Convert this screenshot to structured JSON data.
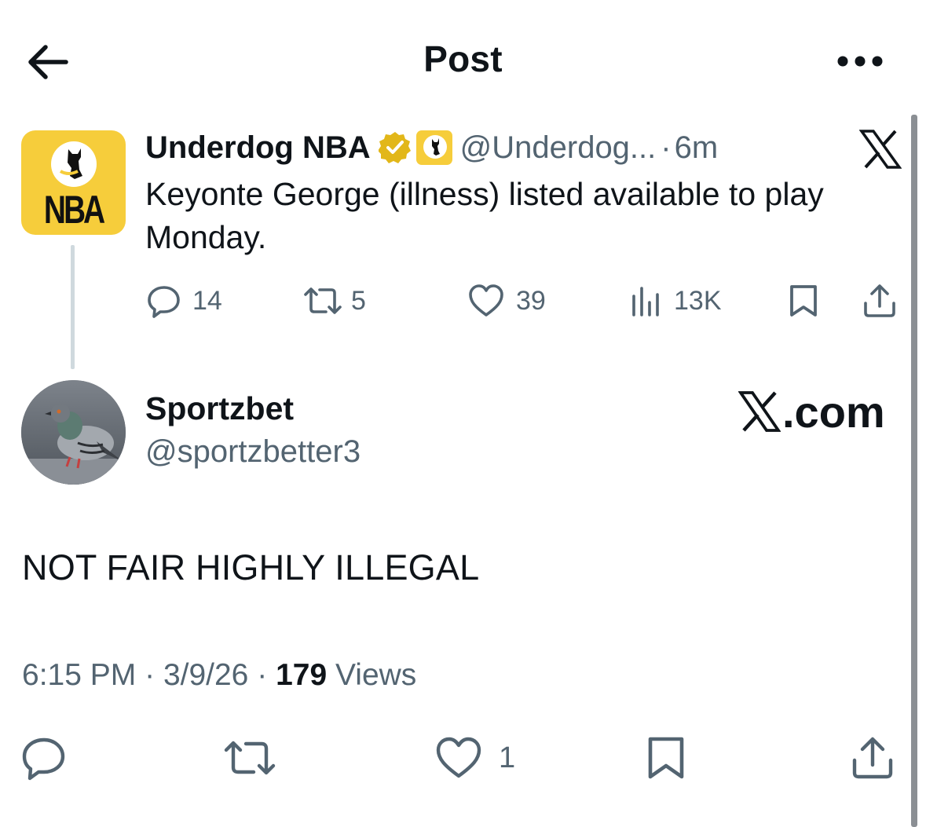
{
  "header": {
    "title": "Post",
    "back_icon": "arrow-left-icon",
    "more_icon": "more-horizontal-icon"
  },
  "quoted_post": {
    "author_name": "Underdog NBA",
    "avatar_text": "NBA",
    "handle": "@Underdog...",
    "separator": "·",
    "time": "6m",
    "text": "Keyonte George (illness) listed available to play Monday.",
    "replies": "14",
    "reposts": "5",
    "likes": "39",
    "views": "13K",
    "brand_color": "#f6cd3b"
  },
  "post": {
    "author_name": "Sportzbet",
    "handle": "@sportzbetter3",
    "watermark": ".com",
    "text": "NOT FAIR HIGHLY ILLEGAL",
    "time": "6:15 PM",
    "date": "3/9/26",
    "sep1": "·",
    "sep2": "·",
    "views_count": "179",
    "views_label": "Views",
    "likes": "1"
  },
  "colors": {
    "text": "#0f1419",
    "muted": "#536471",
    "verified_gold": "#e2b719"
  }
}
